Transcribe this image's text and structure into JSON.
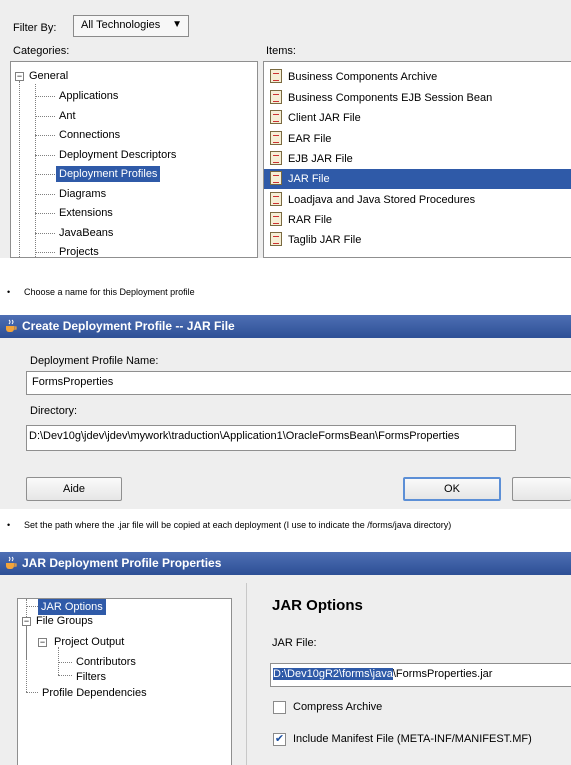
{
  "panel1": {
    "filter_label": "Filter By:",
    "filter_value": "All Technologies",
    "categories_label": "Categories:",
    "items_label": "Items:",
    "categories": {
      "root": "General",
      "children": [
        "Applications",
        "Ant",
        "Connections",
        "Deployment Descriptors",
        "Deployment Profiles",
        "Diagrams",
        "Extensions",
        "JavaBeans",
        "Projects"
      ],
      "selected": "Deployment Profiles"
    },
    "items": [
      "Business Components Archive",
      "Business Components EJB Session Bean",
      "Client JAR File",
      "EAR File",
      "EJB JAR File",
      "JAR File",
      "Loadjava and Java Stored Procedures",
      "RAR File",
      "Taglib JAR File"
    ],
    "selected_item": "JAR File"
  },
  "bullets": [
    "Choose a name for this Deployment profile",
    "Set the path where the .jar file will be copied at each deployment (I use to indicate the /forms/java directory)"
  ],
  "dialog2": {
    "title": "Create Deployment Profile -- JAR File",
    "name_label": "Deployment Profile Name:",
    "name_value": "FormsProperties",
    "dir_label": "Directory:",
    "dir_value": "D:\\Dev10g\\jdev\\jdev\\mywork\\traduction\\Application1\\OracleFormsBean\\FormsProperties",
    "help_button": "Aide",
    "ok_button": "OK"
  },
  "dialog3": {
    "title": "JAR Deployment Profile Properties",
    "tree": [
      "JAR Options",
      "File Groups",
      "Project Output",
      "Contributors",
      "Filters",
      "Profile Dependencies"
    ],
    "selected": "JAR Options",
    "heading": "JAR Options",
    "jar_file_label": "JAR File:",
    "jar_path_selected": "D:\\Dev10gR2\\forms\\java",
    "jar_path_rest": "\\FormsProperties.jar",
    "compress_label": "Compress Archive",
    "compress_checked": false,
    "manifest_label": "Include Manifest File (META-INF/MANIFEST.MF)",
    "manifest_checked": true
  }
}
